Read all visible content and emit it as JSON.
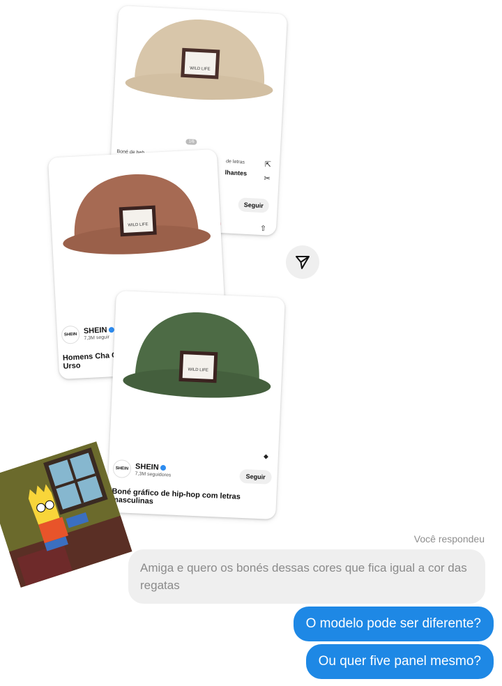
{
  "shared_posts": [
    {
      "cap_color": "#d8c6aa",
      "caption_left": "Boné de beb",
      "caption_right": "de letras",
      "badge": "1/6",
      "title_fragment": "lhantes",
      "follow_label": "Seguir"
    },
    {
      "cap_color": "#a66a53",
      "channel": "SHEIN",
      "subscribers": "7,3M seguir",
      "title": "Homens Cha Carta & Urso",
      "follow_label": "Seguir"
    },
    {
      "cap_color": "#4d6b45",
      "channel": "SHEIN",
      "subscribers": "7,3M seguidores",
      "title": "Boné gráfico de hip-hop com letras masculinas",
      "follow_label": "Seguir"
    }
  ],
  "patch_text": "WILD LIFE",
  "avatar_text": "SHEIN",
  "reply_label": "Você respondeu",
  "quoted_message": "Amiga e quero os bonés dessas cores que fica igual a cor das regatas",
  "messages": [
    {
      "text": "O modelo pode ser diferente?"
    },
    {
      "text": "Ou quer five panel mesmo?"
    }
  ],
  "colors": {
    "bubble_blue": "#1e88e5",
    "quote_bg": "#efefef",
    "accent_red": "#e60023"
  },
  "icons": [
    "send-icon",
    "tag-icon",
    "scissors-icon",
    "external-link-icon",
    "share-icon",
    "verified-icon"
  ]
}
